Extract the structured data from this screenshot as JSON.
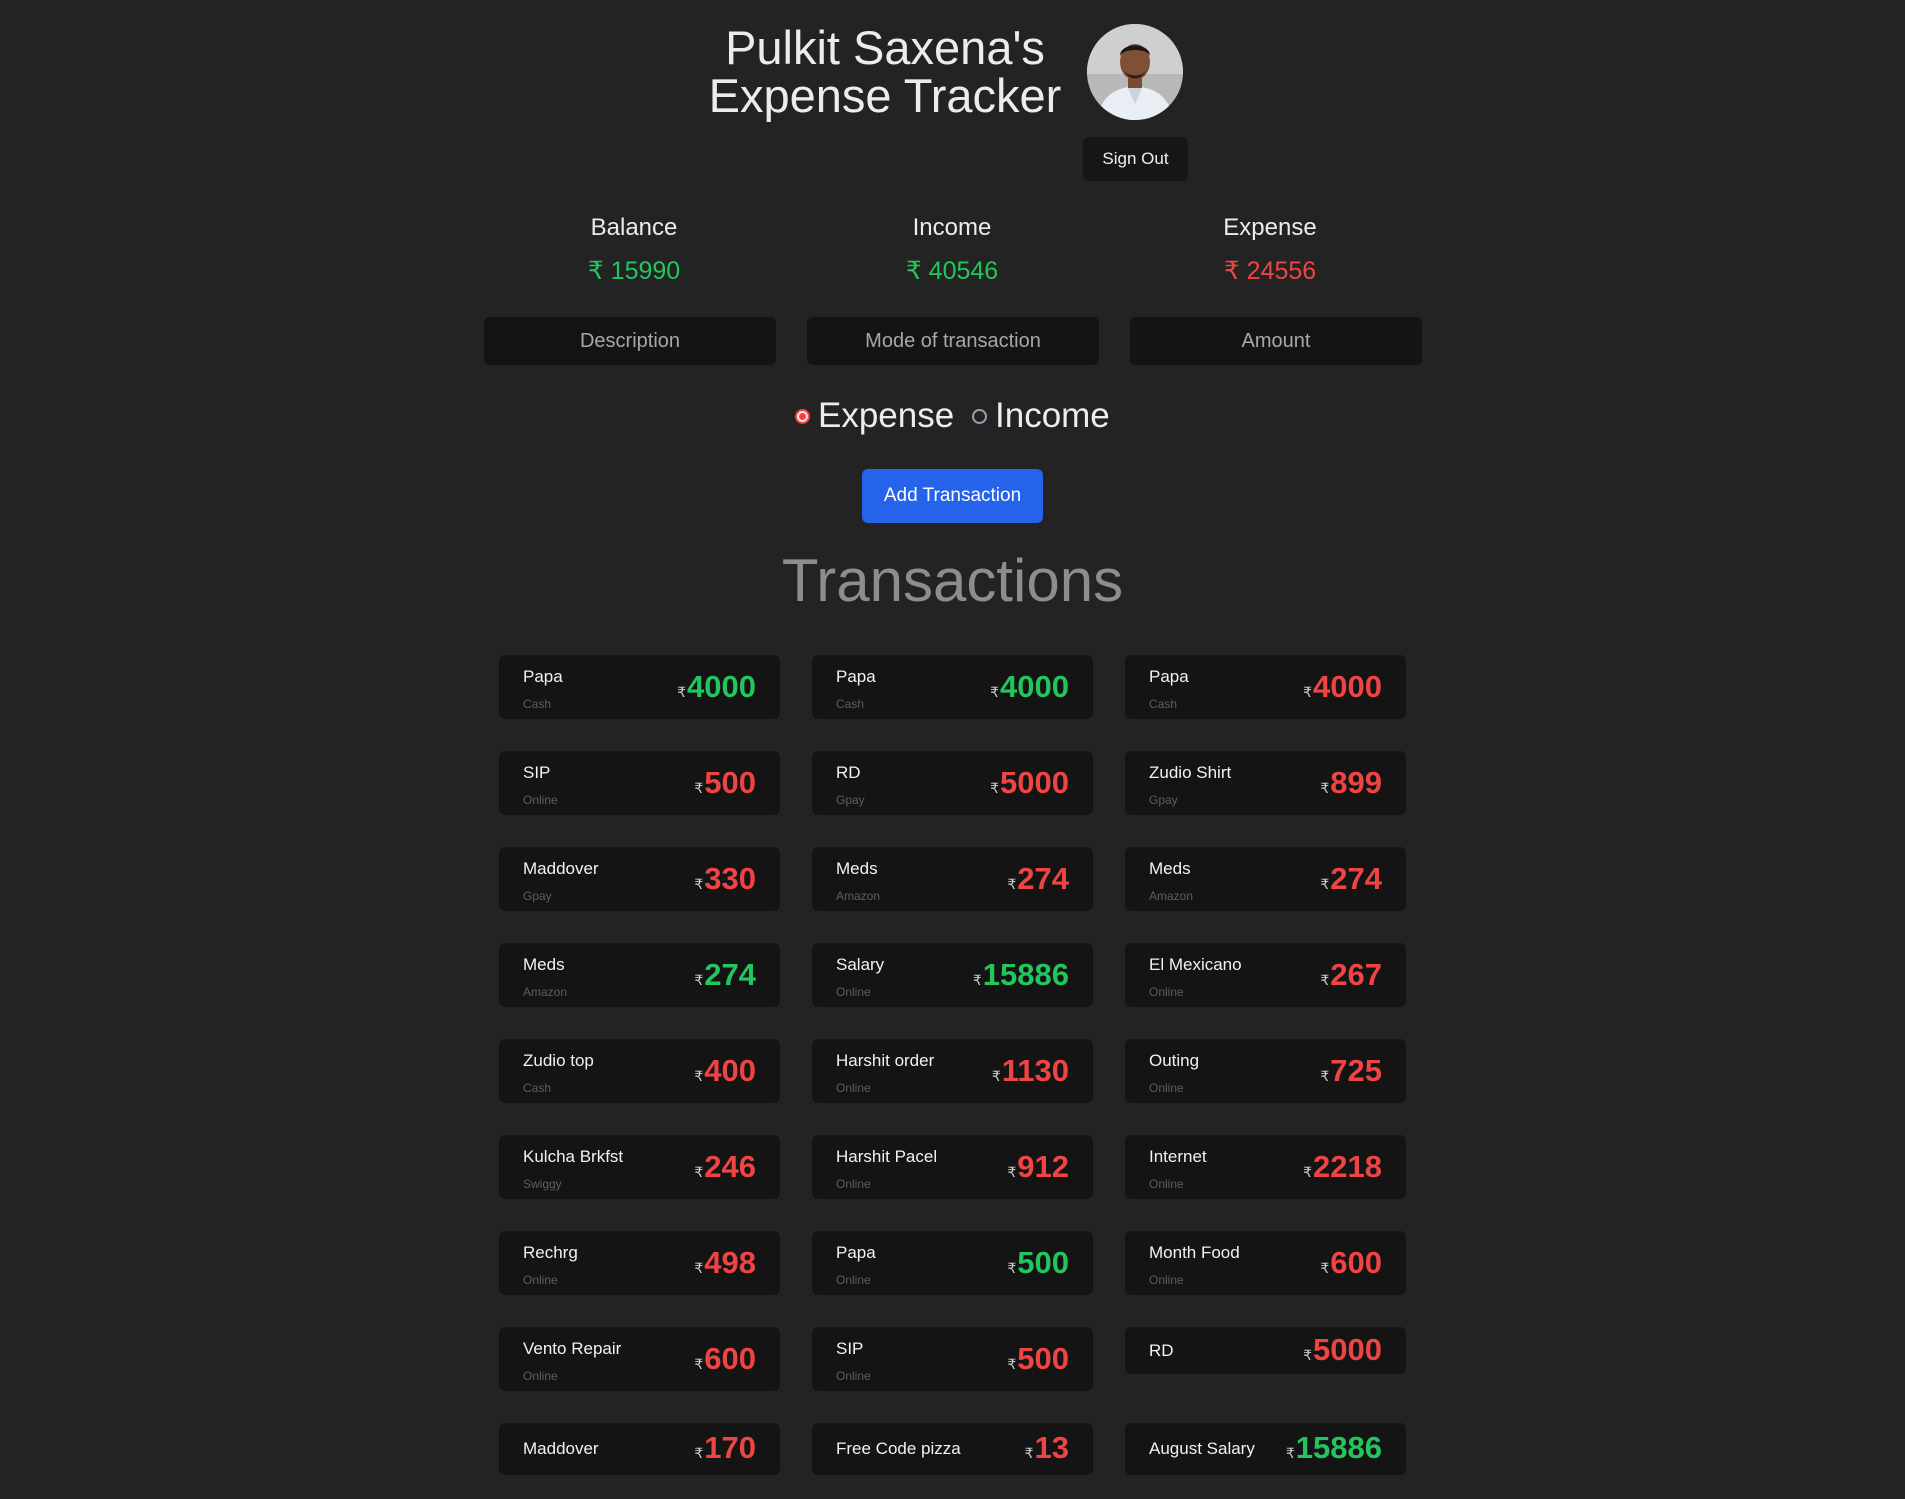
{
  "header": {
    "title_line1": "Pulkit Saxena's",
    "title_line2": "Expense Tracker",
    "signout_label": "Sign Out"
  },
  "summary": {
    "balance_label": "Balance",
    "balance_value": "₹ 15990",
    "income_label": "Income",
    "income_value": "₹ 40546",
    "expense_label": "Expense",
    "expense_value": "₹ 24556"
  },
  "form": {
    "description_placeholder": "Description",
    "mode_placeholder": "Mode of transaction",
    "amount_placeholder": "Amount",
    "radio_expense": "Expense",
    "radio_income": "Income",
    "selected_type": "Expense",
    "add_button": "Add Transaction"
  },
  "transactions_heading": "Transactions",
  "colors": {
    "income": "#22c55e",
    "expense": "#ef4444",
    "accent": "#2563eb"
  },
  "currency_symbol": "₹",
  "transactions": [
    {
      "desc": "Papa",
      "mode": "Cash",
      "amount": "4000",
      "type": "income"
    },
    {
      "desc": "Papa",
      "mode": "Cash",
      "amount": "4000",
      "type": "income"
    },
    {
      "desc": "Papa",
      "mode": "Cash",
      "amount": "4000",
      "type": "expense"
    },
    {
      "desc": "SIP",
      "mode": "Online",
      "amount": "500",
      "type": "expense"
    },
    {
      "desc": "RD",
      "mode": "Gpay",
      "amount": "5000",
      "type": "expense"
    },
    {
      "desc": "Zudio Shirt",
      "mode": "Gpay",
      "amount": "899",
      "type": "expense"
    },
    {
      "desc": "Maddover",
      "mode": "Gpay",
      "amount": "330",
      "type": "expense"
    },
    {
      "desc": "Meds",
      "mode": "Amazon",
      "amount": "274",
      "type": "expense"
    },
    {
      "desc": "Meds",
      "mode": "Amazon",
      "amount": "274",
      "type": "expense"
    },
    {
      "desc": "Meds",
      "mode": "Amazon",
      "amount": "274",
      "type": "income"
    },
    {
      "desc": "Salary",
      "mode": "Online",
      "amount": "15886",
      "type": "income"
    },
    {
      "desc": "El Mexicano",
      "mode": "Online",
      "amount": "267",
      "type": "expense"
    },
    {
      "desc": "Zudio top",
      "mode": "Cash",
      "amount": "400",
      "type": "expense"
    },
    {
      "desc": "Harshit order",
      "mode": "Online",
      "amount": "1130",
      "type": "expense"
    },
    {
      "desc": "Outing",
      "mode": "Online",
      "amount": "725",
      "type": "expense"
    },
    {
      "desc": "Kulcha Brkfst",
      "mode": "Swiggy",
      "amount": "246",
      "type": "expense"
    },
    {
      "desc": "Harshit Pacel",
      "mode": "Online",
      "amount": "912",
      "type": "expense"
    },
    {
      "desc": "Internet",
      "mode": "Online",
      "amount": "2218",
      "type": "expense"
    },
    {
      "desc": "Rechrg",
      "mode": "Online",
      "amount": "498",
      "type": "expense"
    },
    {
      "desc": "Papa",
      "mode": "Online",
      "amount": "500",
      "type": "income"
    },
    {
      "desc": "Month Food",
      "mode": "Online",
      "amount": "600",
      "type": "expense"
    },
    {
      "desc": "Vento Repair",
      "mode": "Online",
      "amount": "600",
      "type": "expense"
    },
    {
      "desc": "SIP",
      "mode": "Online",
      "amount": "500",
      "type": "expense"
    },
    {
      "desc": "RD",
      "mode": "",
      "amount": "5000",
      "type": "expense"
    },
    {
      "desc": "Maddover",
      "mode": "",
      "amount": "170",
      "type": "expense"
    },
    {
      "desc": "Free Code pizza",
      "mode": "",
      "amount": "13",
      "type": "expense"
    },
    {
      "desc": "August Salary",
      "mode": "",
      "amount": "15886",
      "type": "income"
    }
  ]
}
